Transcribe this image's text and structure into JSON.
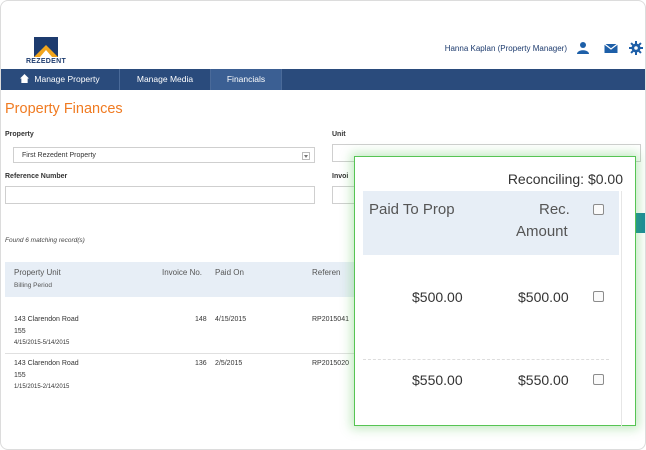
{
  "header": {
    "logo_text": "REZEDENT",
    "user_label": "Hanna Kaplan (Property Manager)",
    "icons": [
      "user-icon",
      "mail-icon",
      "gear-icon"
    ]
  },
  "nav": {
    "home": "Manage Property",
    "media": "Manage Media",
    "financials": "Financials"
  },
  "page": {
    "title": "Property Finances"
  },
  "filters": {
    "property_label": "Property",
    "property_value": "First Rezedent Property",
    "unit_label": "Unit",
    "reference_label": "Reference Number",
    "invoice_label": "Invoi"
  },
  "results": {
    "found_text": "Found 6 matching record(s)"
  },
  "table": {
    "headers": {
      "property_unit": "Property Unit",
      "billing_period": "Billing Period",
      "invoice_no": "Invoice No.",
      "paid_on": "Paid On",
      "reference": "Referen"
    },
    "rows": [
      {
        "address": "143 Clarendon Road",
        "unit": "155",
        "period": "4/15/2015-5/14/2015",
        "invoice": "148",
        "paid_on": "4/15/2015",
        "reference": "RP2015041"
      },
      {
        "address": "143 Clarendon Road",
        "unit": "155",
        "period": "1/15/2015-2/14/2015",
        "invoice": "136",
        "paid_on": "2/5/2015",
        "reference": "RP2015020"
      }
    ]
  },
  "popout": {
    "reconciling": "Reconciling: $0.00",
    "header_paid": "Paid To Prop",
    "header_rec_line1": "Rec.",
    "header_rec_line2": "Amount",
    "rows": [
      {
        "paid": "$500.00",
        "rec": "$500.00"
      },
      {
        "paid": "$550.00",
        "rec": "$550.00"
      }
    ]
  },
  "colors": {
    "nav": "#2a4b7c",
    "title": "#f07b22",
    "highlight": "#56c454",
    "table_header": "#e7eef6"
  }
}
